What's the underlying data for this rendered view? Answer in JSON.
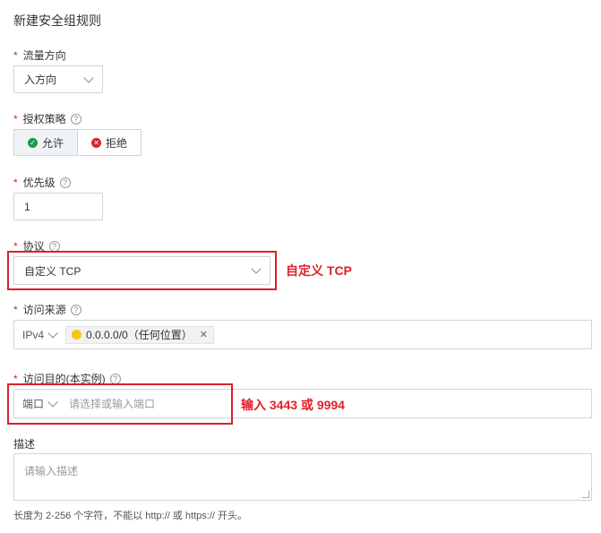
{
  "form": {
    "title": "新建安全组规则",
    "direction": {
      "label": "流量方向",
      "value": "入方向"
    },
    "policy": {
      "label": "授权策略",
      "allow": "允许",
      "deny": "拒绝"
    },
    "priority": {
      "label": "优先级",
      "value": "1"
    },
    "protocol": {
      "label": "协议",
      "value": "自定义 TCP"
    },
    "source": {
      "label": "访问来源",
      "ip_type": "IPv4",
      "tag": "0.0.0.0/0（任何位置）"
    },
    "dest": {
      "label": "访问目的(本实例)",
      "type": "端口",
      "placeholder": "请选择或输入端口"
    },
    "description": {
      "label": "描述",
      "placeholder": "请输入描述",
      "hint": "长度为 2-256 个字符，不能以 http:// 或 https:// 开头。"
    }
  },
  "annotations": {
    "protocol_note": "自定义 TCP",
    "port_note": "输入 3443 或 9994"
  },
  "colors": {
    "allow": "#1a9a4a",
    "deny": "#d9202a",
    "annotation": "#e0202a",
    "required": "#e02020"
  }
}
